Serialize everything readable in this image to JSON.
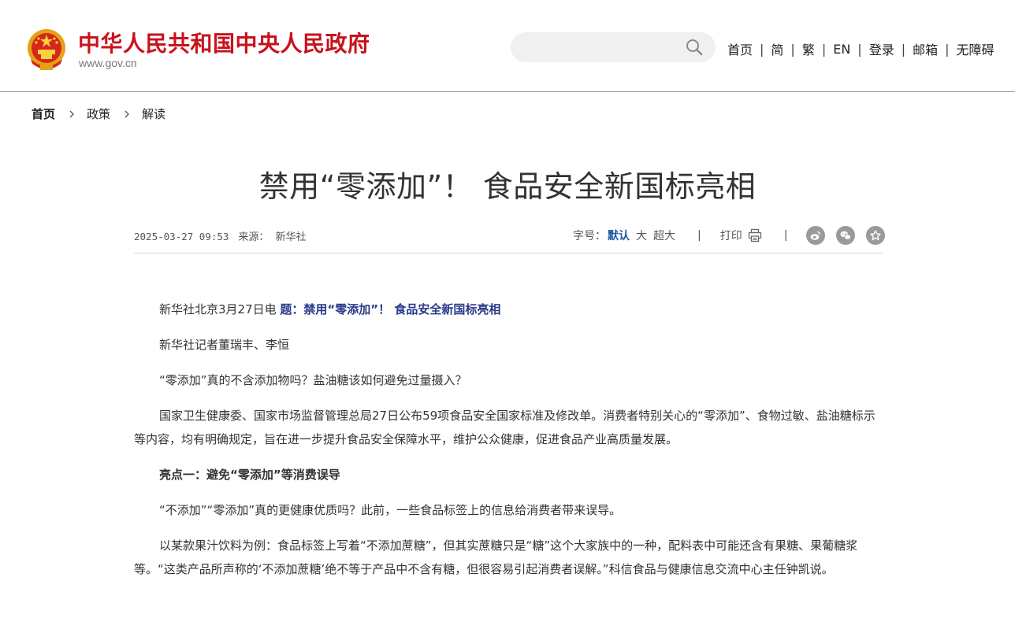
{
  "header": {
    "site_title": "中华人民共和国中央人民政府",
    "site_url": "www.gov.cn",
    "search": {
      "placeholder": "",
      "value": ""
    },
    "nav": [
      "首页",
      "简",
      "繁",
      "EN",
      "登录",
      "邮箱",
      "无障碍"
    ],
    "brand_color": "#c9121d"
  },
  "breadcrumb": [
    "首页",
    "政策",
    "解读"
  ],
  "article": {
    "title": "禁用“零添加”！ 食品安全新国标亮相",
    "date": "2025-03-27 09:53",
    "source_label": "来源：",
    "source": "新华社",
    "font_size_label": "字号：",
    "font_size_options": [
      "默认",
      "大",
      "超大"
    ],
    "print_label": "打印",
    "paragraphs": [
      {
        "lead": "新华社北京3月27日电",
        "emph": "题：禁用“零添加”！ 食品安全新国标亮相"
      },
      {
        "text": "新华社记者董瑞丰、李恒"
      },
      {
        "text": "“零添加”真的不含添加物吗？盐油糖该如何避免过量摄入？"
      },
      {
        "text": "国家卫生健康委、国家市场监督管理总局27日公布59项食品安全国家标准及修改单。消费者特别关心的“零添加”、食物过敏、盐油糖标示等内容，均有明确规定，旨在进一步提升食品安全保障水平，维护公众健康，促进食品产业高质量发展。"
      },
      {
        "heading": "亮点一：避免“零添加”等消费误导"
      },
      {
        "text": "“不添加”“零添加”真的更健康优质吗？此前，一些食品标签上的信息给消费者带来误导。"
      },
      {
        "text": "以某款果汁饮料为例：食品标签上写着“不添加蔗糖”，但其实蔗糖只是“糖”这个大家族中的一种，配料表中可能还含有果糖、果葡糖浆等。“这类产品所声称的‘不添加蔗糖’绝不等于产品中不含有糖，但很容易引起消费者误解。”科信食品与健康信息交流中心主任钟凯说。"
      }
    ]
  },
  "colors": {
    "accent": "#1f5a9e",
    "emphasis": "#2a3a8a"
  }
}
